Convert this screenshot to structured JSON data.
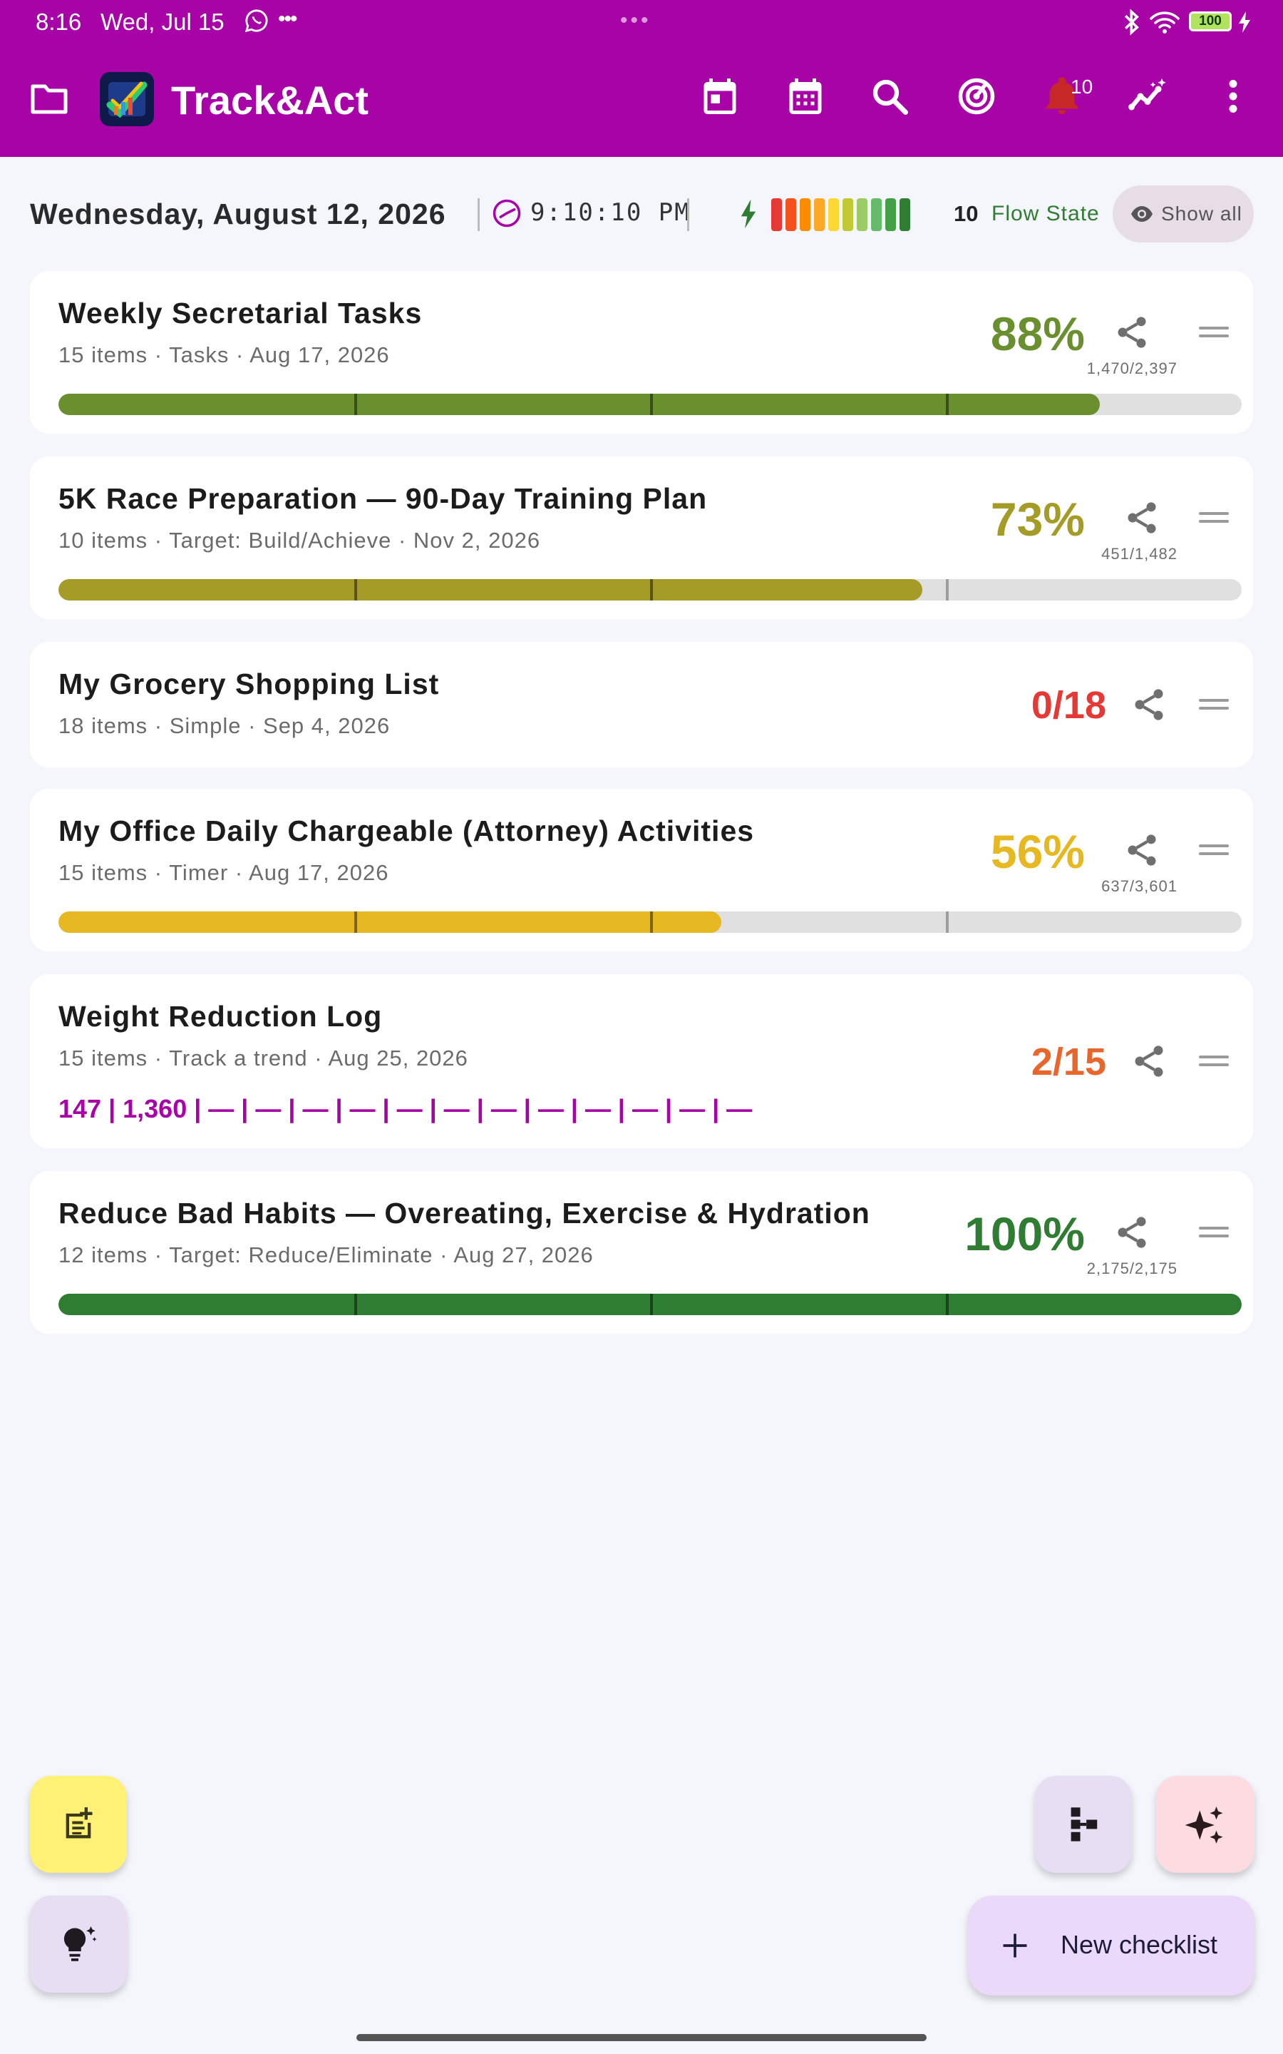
{
  "status_bar": {
    "time": "8:16",
    "date": "Wed, Jul 15",
    "battery": "100"
  },
  "app_bar": {
    "title": "Track&Act",
    "notification_count": "10",
    "icons": [
      "folder-icon",
      "calendar-today-icon",
      "calendar-month-icon",
      "search-icon",
      "radar-icon",
      "bell-icon",
      "insights-icon",
      "more-vert-icon"
    ]
  },
  "header": {
    "date": "Wednesday, August 12, 2026",
    "clock": "9:10:10 PM",
    "flow_level": "10",
    "flow_label": "Flow State",
    "flow_colors": [
      "#e53935",
      "#f4511e",
      "#fb8c00",
      "#ffa726",
      "#fdd835",
      "#c0ca33",
      "#9ccc65",
      "#66bb6a",
      "#43a047",
      "#2e7d32"
    ],
    "show_all_label": "Show all"
  },
  "checklists": [
    {
      "title": "Weekly Secretarial Tasks",
      "subtitle": "15 items · Tasks · Aug 17, 2026",
      "percent": "88%",
      "progress": 0.88,
      "count": "1,470/2,397",
      "color": "#6a8f2f"
    },
    {
      "title": "5K Race Preparation — 90-Day Training Plan",
      "subtitle": "10 items · Target: Build/Achieve · Nov 2, 2026",
      "percent": "73%",
      "progress": 0.73,
      "count": "451/1,482",
      "color": "#a59c28"
    },
    {
      "title": "My Grocery Shopping List",
      "subtitle": "18 items · Simple · Sep 4, 2026",
      "fraction": "0/18",
      "color": "#e53935"
    },
    {
      "title": "My Office Daily Chargeable (Attorney) Activities",
      "subtitle": "15 items · Timer · Aug 17, 2026",
      "percent": "56%",
      "progress": 0.56,
      "count": "637/3,601",
      "color": "#e6b821"
    },
    {
      "title": "Weight Reduction Log",
      "subtitle": "15 items · Track a trend · Aug 25, 2026",
      "fraction": "2/15",
      "trend": "147 | 1,360 | — | — | — | — | — | — | — | — | — | — | — | —",
      "color": "#e8662c"
    },
    {
      "title": "Reduce Bad Habits — Overeating, Exercise & Hydration",
      "subtitle": "12 items · Target: Reduce/Eliminate · Aug 27, 2026",
      "percent": "100%",
      "progress": 1.0,
      "count": "2,175/2,175",
      "color": "#2e7d32"
    }
  ],
  "fabs": {
    "new_checklist_label": "New checklist"
  }
}
